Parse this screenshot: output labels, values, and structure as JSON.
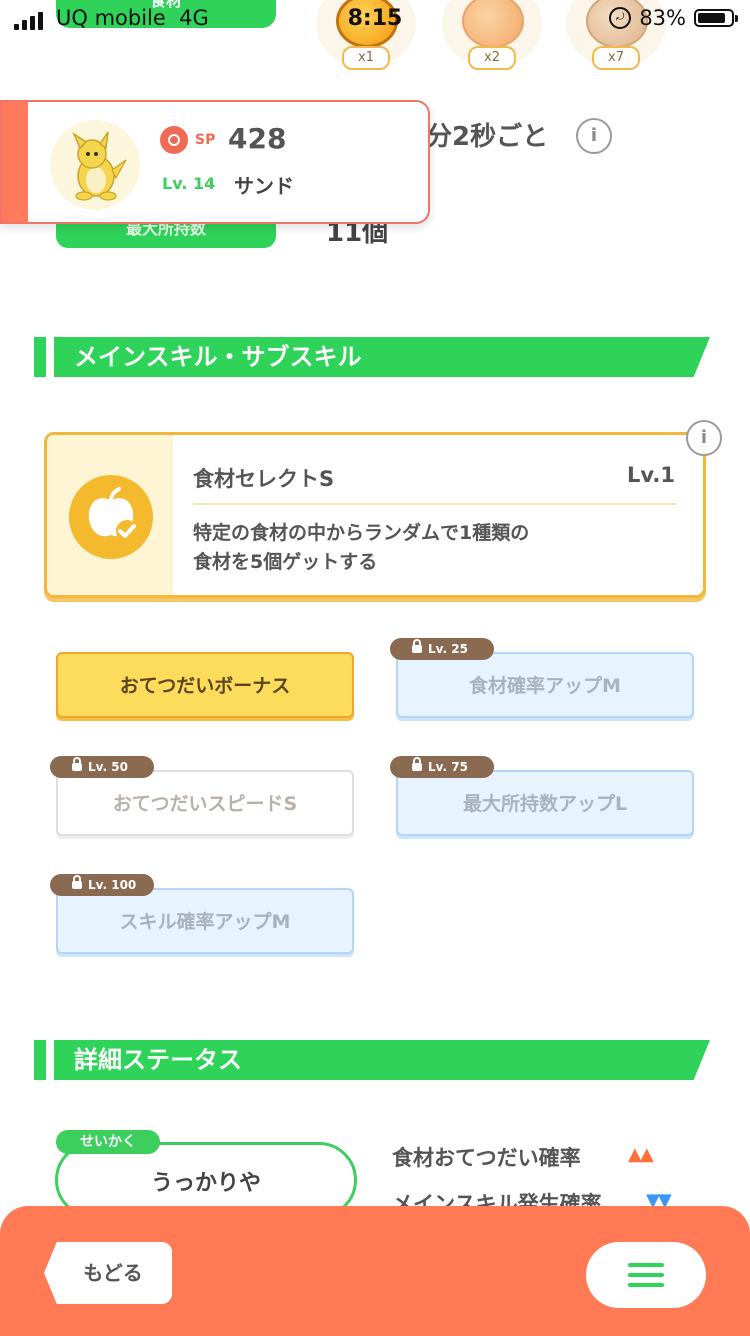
{
  "status_bar": {
    "carrier": "UQ mobile",
    "network": "4G",
    "time": "8:15",
    "battery": "83%",
    "battery_level": 0.83
  },
  "ingredients": {
    "label": "食材",
    "items": [
      {
        "name": "honey-icon",
        "count": "x1",
        "color": "#f4a51c"
      },
      {
        "name": "pumpkin-icon",
        "count": "x2",
        "color": "#f7c18a"
      },
      {
        "name": "potato-icon",
        "count": "x7",
        "color": "#e9c7a1"
      }
    ]
  },
  "help_rate": {
    "text": "分2秒ごと"
  },
  "max_carry": {
    "label": "最大所持数",
    "value": "11個"
  },
  "pokemon": {
    "sp_label": "SP",
    "sp_value": "428",
    "level": "Lv. 14",
    "name": "サンド"
  },
  "sections": {
    "skills_title": "メインスキル・サブスキル",
    "details_title": "詳細ステータス"
  },
  "main_skill": {
    "name": "食材セレクトS",
    "level": "Lv.1",
    "description_line1": "特定の食材の中からランダムで1種類の",
    "description_line2": "食材を5個ゲットする"
  },
  "sub_skills": [
    {
      "label": "おてつだいボーナス",
      "unlock": ""
    },
    {
      "label": "食材確率アップM",
      "unlock": "Lv. 25"
    },
    {
      "label": "おてつだいスピードS",
      "unlock": "Lv. 50"
    },
    {
      "label": "最大所持数アップL",
      "unlock": "Lv. 75"
    },
    {
      "label": "スキル確率アップM",
      "unlock": "Lv. 100"
    }
  ],
  "nature": {
    "tag": "せいかく",
    "value": "うっかりや"
  },
  "stats": [
    {
      "label": "食材おてつだい確率",
      "arrows": "▲▲"
    },
    {
      "label": "メインスキル発生確率",
      "arrows": "▼▼"
    }
  ],
  "nav": {
    "back_label": "もどる"
  },
  "colors": {
    "green": "#2fd35a",
    "orange": "#ff7a55",
    "gold": "#f4b63d"
  }
}
